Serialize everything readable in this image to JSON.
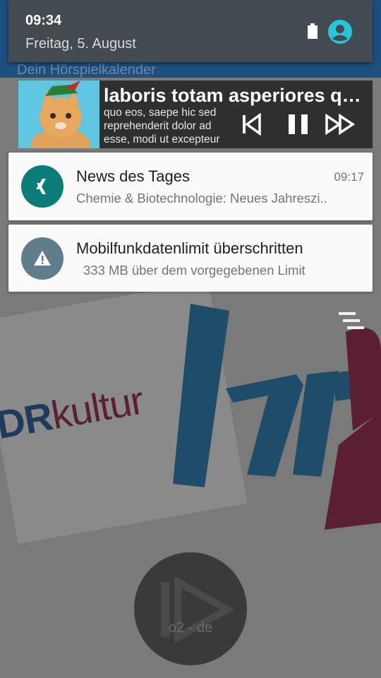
{
  "background_app": {
    "subtitle": "Dein Hörspielkalender",
    "logo_pre": "DR",
    "logo_post": "kultur",
    "play_label": "o2 - de"
  },
  "status": {
    "time": "09:34",
    "date": "Freitag, 5. August",
    "icons": [
      "battery-icon",
      "account-icon"
    ]
  },
  "media": {
    "title": "laboris totam asperiores quasi",
    "body": "quo eos, saepe hic sed reprehenderit dolor ad esse, modi ut excepteur",
    "controls": [
      "previous",
      "pause",
      "next"
    ]
  },
  "notifications": [
    {
      "app_icon": "xing-icon",
      "title": "News des Tages",
      "time": "09:17",
      "text": "Chemie & Biotechnologie: Neues Jahreszi.."
    },
    {
      "app_icon": "warning-icon",
      "title": "Mobilfunkdatenlimit überschritten",
      "text": "333 MB über dem vorgegebenen Limit"
    }
  ],
  "colors": {
    "news_icon_bg": "#0b7c77",
    "warning_icon_bg": "#607d8b",
    "account_icon": "#26c6da"
  }
}
